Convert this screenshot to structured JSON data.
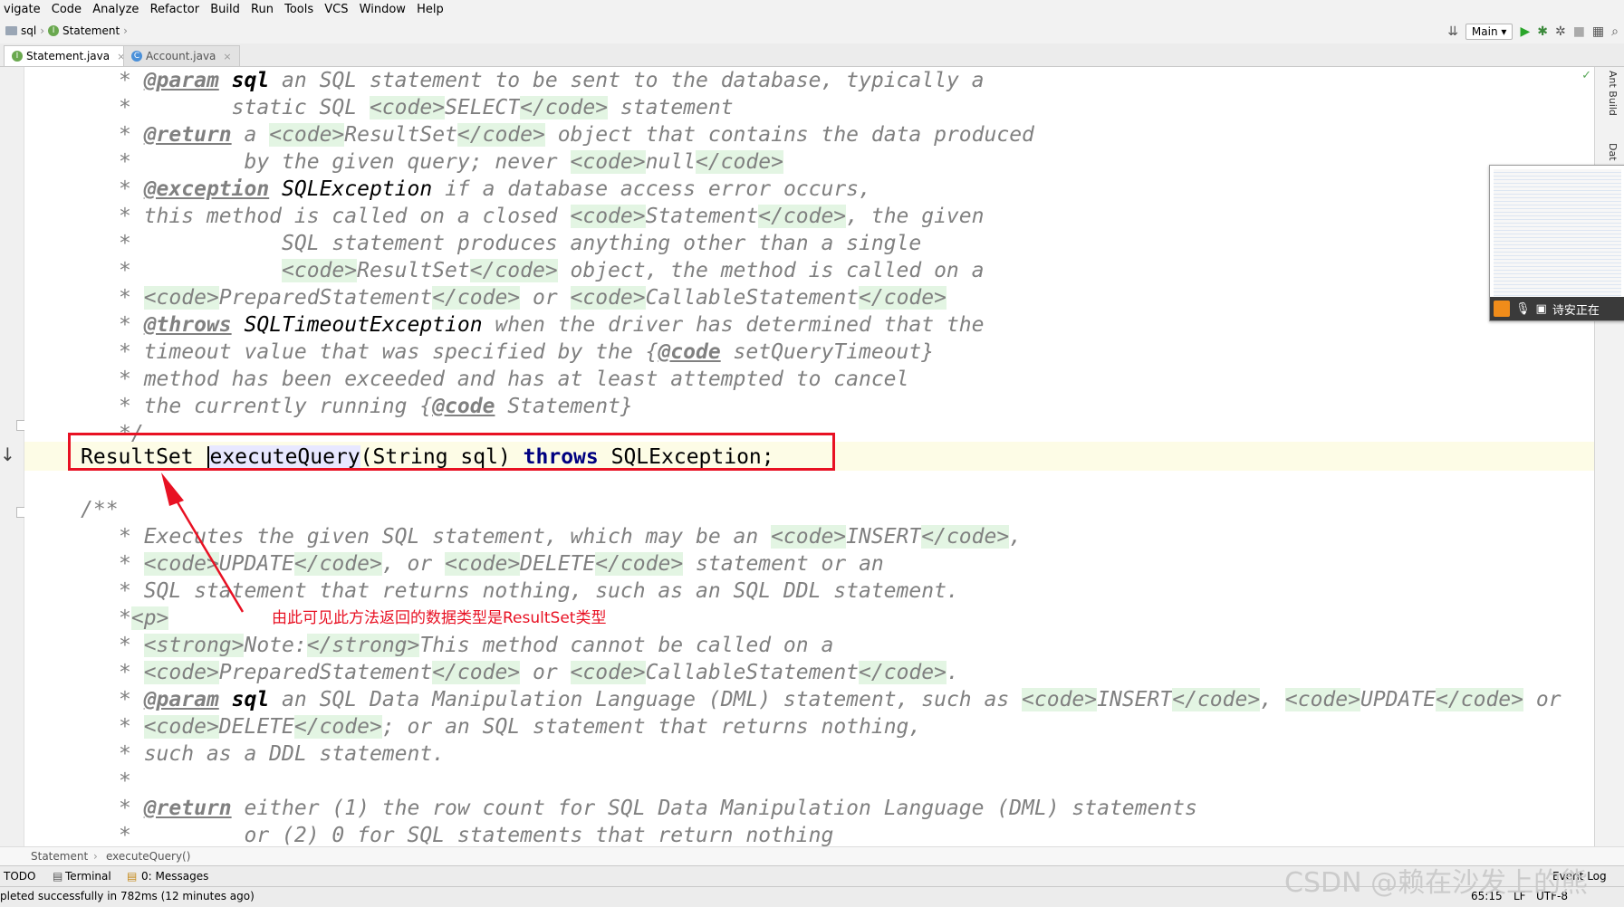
{
  "menu": [
    "vigate",
    "Code",
    "Analyze",
    "Refactor",
    "Build",
    "Run",
    "Tools",
    "VCS",
    "Window",
    "Help"
  ],
  "breadcrumb": {
    "project": "sql",
    "file": "Statement"
  },
  "toolbar": {
    "run_config": "Main"
  },
  "tabs": [
    {
      "label": "Statement.java",
      "active": true
    },
    {
      "label": "Account.java",
      "active": false
    }
  ],
  "code": {
    "doc1": [
      [
        {
          "t": "* ",
          "c": "cm"
        },
        {
          "t": "@param",
          "c": "tagk"
        },
        {
          "t": " ",
          "c": "cm"
        },
        {
          "t": "sql",
          "c": "identb"
        },
        {
          "t": " an SQL statement to be sent to the database, typically a",
          "c": "cm"
        }
      ],
      [
        {
          "t": "*        static SQL ",
          "c": "cm"
        },
        {
          "t": "<code>",
          "c": "h"
        },
        {
          "t": "SELECT",
          "c": "cm"
        },
        {
          "t": "</code>",
          "c": "h"
        },
        {
          "t": " statement",
          "c": "cm"
        }
      ],
      [
        {
          "t": "* ",
          "c": "cm"
        },
        {
          "t": "@return",
          "c": "tagk"
        },
        {
          "t": " a ",
          "c": "cm"
        },
        {
          "t": "<code>",
          "c": "h"
        },
        {
          "t": "ResultSet",
          "c": "cm"
        },
        {
          "t": "</code>",
          "c": "h"
        },
        {
          "t": " object that contains the data produced",
          "c": "cm"
        }
      ],
      [
        {
          "t": "*         by the given query; never ",
          "c": "cm"
        },
        {
          "t": "<code>",
          "c": "h"
        },
        {
          "t": "null",
          "c": "cm"
        },
        {
          "t": "</code>",
          "c": "h"
        }
      ],
      [
        {
          "t": "* ",
          "c": "cm"
        },
        {
          "t": "@exception",
          "c": "tagk"
        },
        {
          "t": " ",
          "c": "cm"
        },
        {
          "t": "SQLException",
          "c": "ident"
        },
        {
          "t": " if a database access error occurs,",
          "c": "cm"
        }
      ],
      [
        {
          "t": "* this method is called on a closed ",
          "c": "cm"
        },
        {
          "t": "<code>",
          "c": "h"
        },
        {
          "t": "Statement",
          "c": "cm"
        },
        {
          "t": "</code>",
          "c": "h"
        },
        {
          "t": ", the given",
          "c": "cm"
        }
      ],
      [
        {
          "t": "*            SQL statement produces anything other than a single",
          "c": "cm"
        }
      ],
      [
        {
          "t": "*            ",
          "c": "cm"
        },
        {
          "t": "<code>",
          "c": "h"
        },
        {
          "t": "ResultSet",
          "c": "cm"
        },
        {
          "t": "</code>",
          "c": "h"
        },
        {
          "t": " object, the method is called on a",
          "c": "cm"
        }
      ],
      [
        {
          "t": "* ",
          "c": "cm"
        },
        {
          "t": "<code>",
          "c": "h"
        },
        {
          "t": "PreparedStatement",
          "c": "cm"
        },
        {
          "t": "</code>",
          "c": "h"
        },
        {
          "t": " or ",
          "c": "cm"
        },
        {
          "t": "<code>",
          "c": "h"
        },
        {
          "t": "CallableStatement",
          "c": "cm"
        },
        {
          "t": "</code>",
          "c": "h"
        }
      ],
      [
        {
          "t": "* ",
          "c": "cm"
        },
        {
          "t": "@throws",
          "c": "tagk"
        },
        {
          "t": " ",
          "c": "cm"
        },
        {
          "t": "SQLTimeoutException",
          "c": "ident"
        },
        {
          "t": " when the driver has determined that the",
          "c": "cm"
        }
      ],
      [
        {
          "t": "* timeout value that was specified by the {",
          "c": "cm"
        },
        {
          "t": "@code",
          "c": "tagk"
        },
        {
          "t": " setQueryTimeout}",
          "c": "cm"
        }
      ],
      [
        {
          "t": "* method has been exceeded and has at least attempted to cancel",
          "c": "cm"
        }
      ],
      [
        {
          "t": "* the currently running {",
          "c": "cm"
        },
        {
          "t": "@code",
          "c": "tagk"
        },
        {
          "t": " Statement}",
          "c": "cm"
        }
      ],
      [
        {
          "t": "*/",
          "c": "cm"
        }
      ]
    ],
    "method": {
      "ret": "ResultSet",
      "name": "executeQuery",
      "params": "(String sql) ",
      "throws": "throws",
      "exc": " SQLException;"
    },
    "doc2": [
      [
        {
          "t": "/**",
          "c": "cm"
        }
      ],
      [
        {
          "t": "* Executes the given SQL statement, which may be an ",
          "c": "cm"
        },
        {
          "t": "<code>",
          "c": "h"
        },
        {
          "t": "INSERT",
          "c": "cm"
        },
        {
          "t": "</code>",
          "c": "h"
        },
        {
          "t": ",",
          "c": "cm"
        }
      ],
      [
        {
          "t": "* ",
          "c": "cm"
        },
        {
          "t": "<code>",
          "c": "h"
        },
        {
          "t": "UPDATE",
          "c": "cm"
        },
        {
          "t": "</code>",
          "c": "h"
        },
        {
          "t": ", or ",
          "c": "cm"
        },
        {
          "t": "<code>",
          "c": "h"
        },
        {
          "t": "DELETE",
          "c": "cm"
        },
        {
          "t": "</code>",
          "c": "h"
        },
        {
          "t": " statement or an",
          "c": "cm"
        }
      ],
      [
        {
          "t": "* SQL statement that returns nothing, such as an SQL DDL statement.",
          "c": "cm"
        }
      ],
      [
        {
          "t": "*",
          "c": "cm"
        },
        {
          "t": "<p>",
          "c": "h"
        }
      ],
      [
        {
          "t": "* ",
          "c": "cm"
        },
        {
          "t": "<strong>",
          "c": "h"
        },
        {
          "t": "Note:",
          "c": "cm"
        },
        {
          "t": "</strong>",
          "c": "h"
        },
        {
          "t": "This method cannot be called on a",
          "c": "cm"
        }
      ],
      [
        {
          "t": "* ",
          "c": "cm"
        },
        {
          "t": "<code>",
          "c": "h"
        },
        {
          "t": "PreparedStatement",
          "c": "cm"
        },
        {
          "t": "</code>",
          "c": "h"
        },
        {
          "t": " or ",
          "c": "cm"
        },
        {
          "t": "<code>",
          "c": "h"
        },
        {
          "t": "CallableStatement",
          "c": "cm"
        },
        {
          "t": "</code>",
          "c": "h"
        },
        {
          "t": ".",
          "c": "cm"
        }
      ],
      [
        {
          "t": "* ",
          "c": "cm"
        },
        {
          "t": "@param",
          "c": "tagk"
        },
        {
          "t": " ",
          "c": "cm"
        },
        {
          "t": "sql",
          "c": "identb"
        },
        {
          "t": " an SQL Data Manipulation Language (DML) statement, such as ",
          "c": "cm"
        },
        {
          "t": "<code>",
          "c": "h"
        },
        {
          "t": "INSERT",
          "c": "cm"
        },
        {
          "t": "</code>",
          "c": "h"
        },
        {
          "t": ", ",
          "c": "cm"
        },
        {
          "t": "<code>",
          "c": "h"
        },
        {
          "t": "UPDATE",
          "c": "cm"
        },
        {
          "t": "</code>",
          "c": "h"
        },
        {
          "t": " or",
          "c": "cm"
        }
      ],
      [
        {
          "t": "* ",
          "c": "cm"
        },
        {
          "t": "<code>",
          "c": "h"
        },
        {
          "t": "DELETE",
          "c": "cm"
        },
        {
          "t": "</code>",
          "c": "h"
        },
        {
          "t": "; or an SQL statement that returns nothing,",
          "c": "cm"
        }
      ],
      [
        {
          "t": "* such as a DDL statement.",
          "c": "cm"
        }
      ],
      [
        {
          "t": "*",
          "c": "cm"
        }
      ],
      [
        {
          "t": "* ",
          "c": "cm"
        },
        {
          "t": "@return",
          "c": "tagk"
        },
        {
          "t": " either (1) the row count for SQL Data Manipulation Language (DML) statements",
          "c": "cm"
        }
      ],
      [
        {
          "t": "*         or (2) 0 for SQL statements that return nothing",
          "c": "cm"
        }
      ]
    ]
  },
  "annotation": "由此可见此方法返回的数据类型是ResultSet类型",
  "right_panel": {
    "ant_build": "Ant Build",
    "database": "Dat"
  },
  "thumbnail": {
    "caption": "诗安正在"
  },
  "footer_breadcrumb": {
    "class": "Statement",
    "method": "executeQuery()"
  },
  "tool_windows": {
    "todo": "TODO",
    "terminal": "Terminal",
    "messages": "0: Messages",
    "event_log": "Event Log"
  },
  "status": {
    "message": "pleted successfully in 782ms (12 minutes ago)",
    "position": "65:15",
    "lf": "LF",
    "encoding": "UTF-8"
  },
  "watermark": "CSDN @赖在沙发上的熊"
}
